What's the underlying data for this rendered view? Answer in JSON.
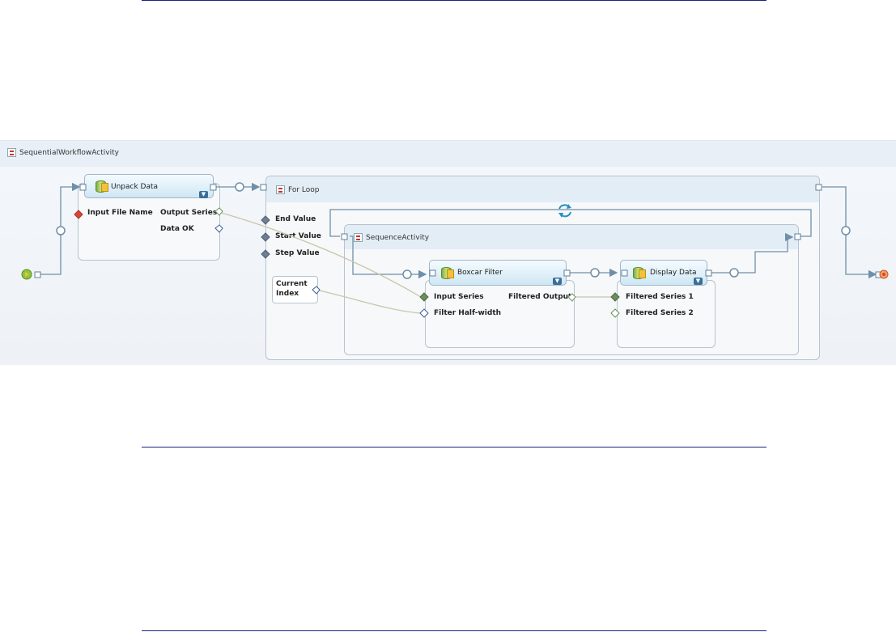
{
  "workflow": {
    "title": "SequentialWorkflowActivity",
    "for_loop": {
      "title": "For Loop",
      "inputs": [
        "End Value",
        "Start Value",
        "Step Value"
      ],
      "variable": "Current\nIndex"
    },
    "sequence": {
      "title": "SequenceActivity"
    },
    "activities": {
      "unpack": {
        "title": "Unpack Data",
        "input": "Input File Name",
        "outputs": [
          "Output Series",
          "Data OK"
        ]
      },
      "boxcar": {
        "title": "Boxcar Filter",
        "inputs": [
          "Input Series",
          "Filter Half-width"
        ],
        "output": "Filtered Output"
      },
      "display": {
        "title": "Display Data",
        "inputs": [
          "Filtered Series 1",
          "Filtered Series 2"
        ]
      }
    },
    "colors": {
      "wire": "#6f8fa8",
      "data_wire": "#c9c6a8",
      "rule": "#1a237e",
      "port_green": "#6c8f5a",
      "port_blue": "#3d5d95",
      "port_red": "#d9472b",
      "start_green": "#8cc63f",
      "loop_arrow": "#2a8fc0"
    },
    "icons": [
      "activity-icon",
      "database-icon",
      "chevron-down-icon",
      "loop-refresh-icon",
      "start-icon",
      "end-icon"
    ]
  }
}
